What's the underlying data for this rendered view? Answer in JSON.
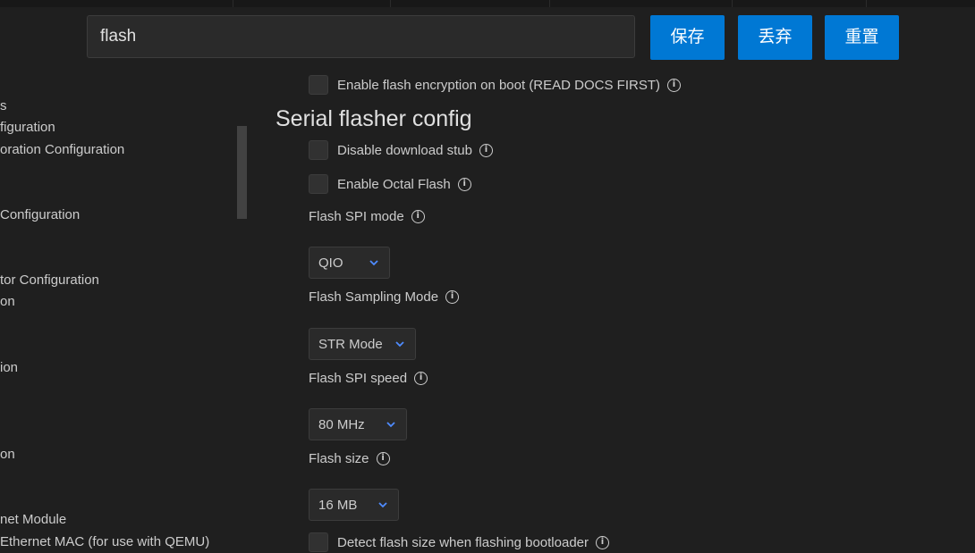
{
  "search": {
    "value": "flash"
  },
  "actions": {
    "save": "保存",
    "discard": "丢弃",
    "reset": "重置"
  },
  "sidebar": {
    "items": [
      "s",
      "figuration",
      "oration Configuration",
      "Configuration",
      "tor Configuration",
      "on",
      "ion",
      "on",
      "net Module",
      "Ethernet MAC (for use with QEMU)"
    ]
  },
  "main": {
    "encryption_label": "Enable flash encryption on boot (READ DOCS FIRST)",
    "section_title": "Serial flasher config",
    "disable_stub_label": "Disable download stub",
    "octal_flash_label": "Enable Octal Flash",
    "spi_mode": {
      "label": "Flash SPI mode",
      "value": "QIO"
    },
    "sampling_mode": {
      "label": "Flash Sampling Mode",
      "value": "STR Mode"
    },
    "spi_speed": {
      "label": "Flash SPI speed",
      "value": "80 MHz"
    },
    "flash_size": {
      "label": "Flash size",
      "value": "16 MB"
    },
    "detect_size_label": "Detect flash size when flashing bootloader"
  },
  "colors": {
    "accent": "#0078d4",
    "background": "#1f1f1f",
    "chevron": "#4f8cff"
  },
  "icons": {
    "info": "info-circle-icon",
    "dropdown": "chevron-down-icon"
  }
}
